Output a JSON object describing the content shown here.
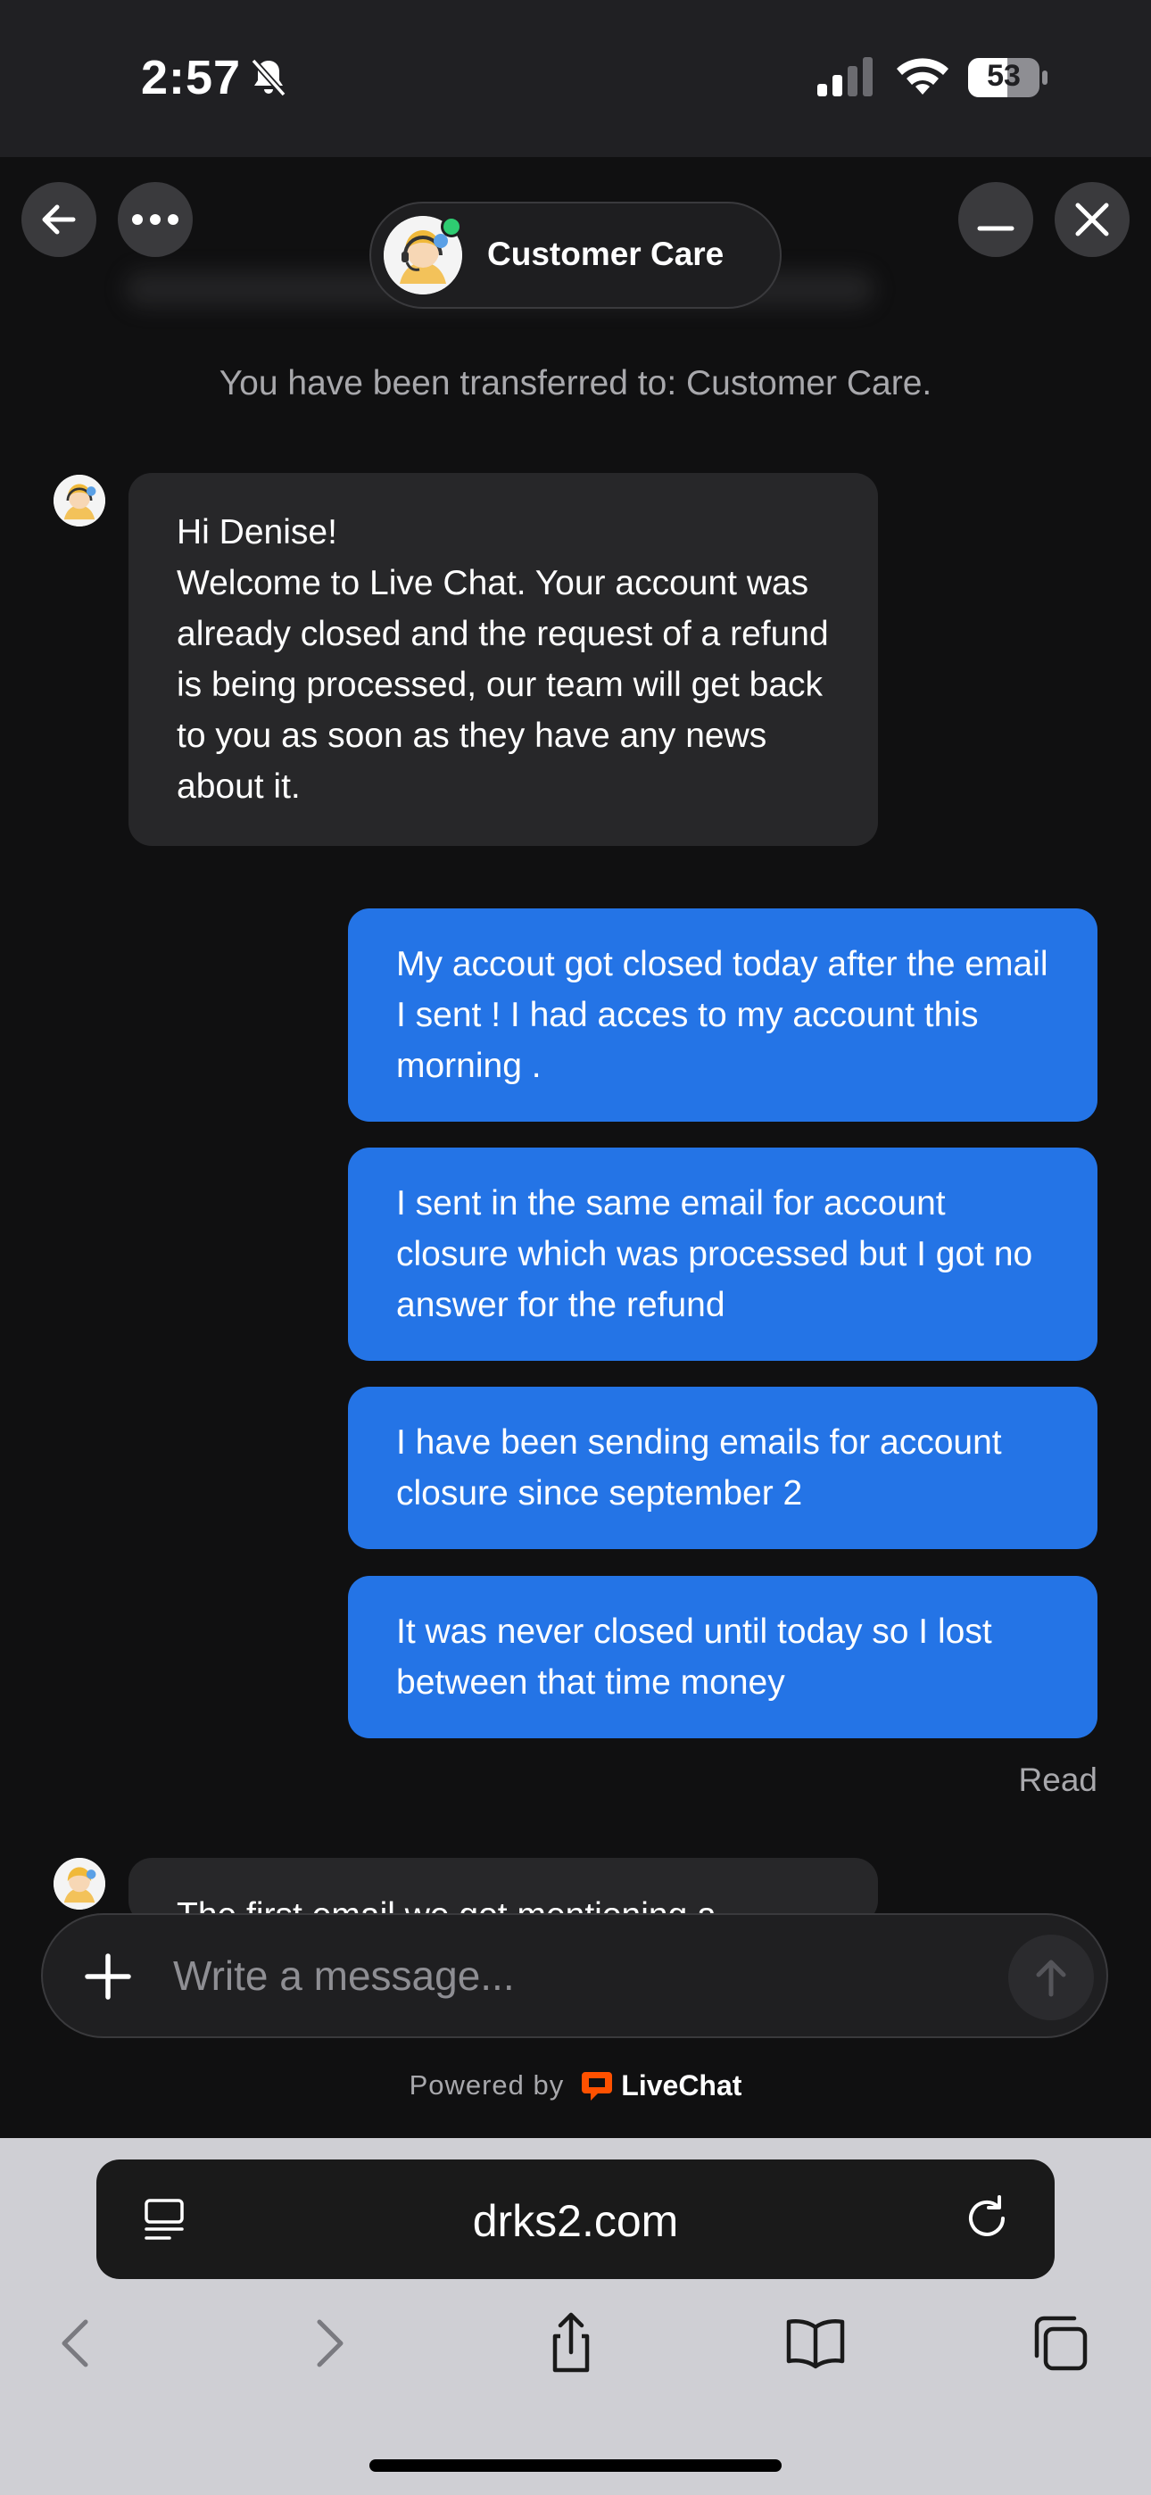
{
  "status_bar": {
    "time": "2:57",
    "battery": "53",
    "icons": [
      "bell-slash-icon",
      "signal-icon",
      "wifi-icon",
      "battery-icon"
    ]
  },
  "chat_header": {
    "title": "Customer Care",
    "online_color": "#2ecc71",
    "icons": [
      "back-arrow-icon",
      "more-dots-icon",
      "minimize-icon",
      "close-icon"
    ]
  },
  "system_message": "You have been transferred to: Customer Care.",
  "messages": {
    "agent_1": {
      "greeting": "Hi Denise!",
      "text": "Welcome to Live Chat. Your account was already closed and the request of a refund is being processed, our team will get back to you as soon as they have any news about it."
    },
    "user_1": "My accout got closed today after the email I sent ! I had acces to my account this morning .",
    "user_2": "I sent in the same email for account closure which was processed but I got no answer for the refund",
    "user_3": "I have been sending emails for account closure since september 2",
    "user_4": "It was never closed until today so I lost between that time money",
    "read_status": "Read",
    "agent_2_partial": "The first email we got mentioning a"
  },
  "composer": {
    "placeholder": "Write a message...",
    "powered_by": "Powered by",
    "brand": "LiveChat",
    "brand_color": "#ff5100"
  },
  "browser": {
    "url": "drks2.com",
    "toolbar_icons": [
      "back-icon",
      "forward-icon",
      "share-icon",
      "bookmarks-icon",
      "tabs-icon"
    ]
  },
  "colors": {
    "user_bubble": "#2474e6",
    "agent_bubble": "#272729",
    "background": "#101011"
  }
}
